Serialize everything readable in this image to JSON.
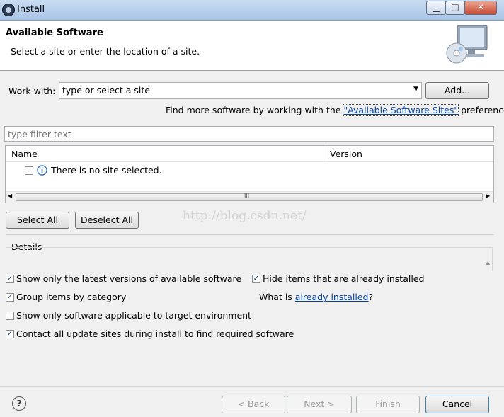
{
  "window": {
    "title": "Install"
  },
  "header": {
    "title": "Available Software",
    "description": "Select a site or enter the location of a site."
  },
  "work_with": {
    "label": "Work with:",
    "value": "type or select a site",
    "add_button": "Add...",
    "info_prefix": "Find more software by working with the",
    "info_link": "\"Available Software Sites\"",
    "info_suffix": "preferences."
  },
  "filter": {
    "placeholder": "type filter text"
  },
  "table": {
    "columns": [
      "Name",
      "Version"
    ],
    "rows": [
      {
        "name": "There is no site selected.",
        "version": ""
      }
    ],
    "scroll_grip": "III"
  },
  "selection_buttons": {
    "select_all": "Select All",
    "deselect_all": "Deselect All"
  },
  "watermark": "http://blog.csdn.net/",
  "details": {
    "label": "Details"
  },
  "options": {
    "latest_versions": {
      "label": "Show only the latest versions of available software",
      "checked": true
    },
    "group_by_category": {
      "label": "Group items by category",
      "checked": true
    },
    "target_env": {
      "label": "Show only software applicable to target environment",
      "checked": false
    },
    "contact_sites": {
      "label": "Contact all update sites during install to find required software",
      "checked": true
    },
    "hide_installed": {
      "label": "Hide items that are already installed",
      "checked": true
    },
    "what_is_prefix": "What is",
    "what_is_link": "already installed",
    "what_is_suffix": "?"
  },
  "footer": {
    "help_glyph": "?",
    "back": "< Back",
    "next": "Next >",
    "finish": "Finish",
    "cancel": "Cancel"
  },
  "colors": {
    "title_bar": "#a9c4e6",
    "link": "#0645ad",
    "close_button": "#c94a32"
  }
}
